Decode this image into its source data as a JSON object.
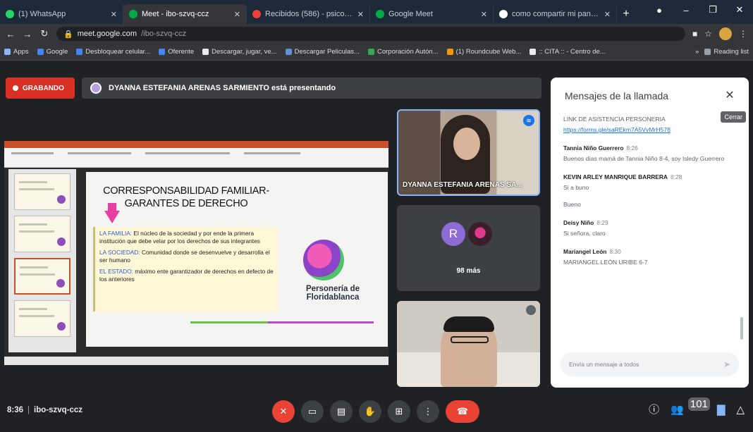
{
  "browser": {
    "tabs": [
      {
        "title": "(1) WhatsApp",
        "color": "#25d366",
        "active": false
      },
      {
        "title": "Meet - ibo-szvq-ccz",
        "color": "#00ac47",
        "active": true
      },
      {
        "title": "Recibidos (586) - psicogame",
        "color": "#ea4335",
        "active": false
      },
      {
        "title": "Google Meet",
        "color": "#00ac47",
        "active": false
      },
      {
        "title": "como compartir mi pantalla",
        "color": "#ffffff",
        "active": false
      }
    ],
    "url_host": "meet.google.com",
    "url_path": "/ibo-szvq-ccz",
    "bookmarks": [
      {
        "label": "Apps",
        "color": "#8ab4f8"
      },
      {
        "label": "Google",
        "color": "#4285f4"
      },
      {
        "label": "Desbloquear celular...",
        "color": "#4285f4"
      },
      {
        "label": "Oferente",
        "color": "#4285f4"
      },
      {
        "label": "Descargar, jugar, ve...",
        "color": "#e8eaed"
      },
      {
        "label": "Descargar Peliculas...",
        "color": "#5f8fd6"
      },
      {
        "label": "Corporación Autón...",
        "color": "#34a853"
      },
      {
        "label": "(1) Roundcube Web...",
        "color": "#f29900"
      },
      {
        "label": ":: CITA :: - Centro de...",
        "color": "#e8eaed"
      }
    ],
    "reading_list": "Reading list"
  },
  "meet": {
    "recording_label": "GRABANDO",
    "presenting_text": "DYANNA ESTEFANIA ARENAS SARMIENTO está presentando",
    "slide": {
      "title": "CORRESPONSABILIDAD FAMILIAR-\nGARANTES DE DERECHO",
      "items": [
        {
          "key": "LA FAMILIA:",
          "text": " El núcleo de la sociedad y por ende la primera institución que debe velar por los derechos de sus integrantes"
        },
        {
          "key": "LA SOCIEDAD:",
          "text": " Comunidad donde se desenvuelve y desarrolla el ser humano"
        },
        {
          "key": "EL ESTADO:",
          "text": " máximo ente garantizador de derechos en defecto de los anteriores"
        }
      ],
      "brand": "Personería de\nFloridablanca"
    },
    "participants": {
      "presenter_name": "DYANNA ESTEFANIA ARENAS SA...",
      "avatar_letter": "R",
      "more_label": "98 más"
    },
    "chat": {
      "title": "Mensajes de la llamada",
      "close_tooltip": "Cerrar",
      "messages": [
        {
          "author": "",
          "time": "",
          "body": "LINK DE ASISTENCIA PERSONERIA",
          "link": "https://forms.gle/saREkm7A5VvMrH578"
        },
        {
          "author": "Tannia Niño Guerrero",
          "time": "8:26",
          "body": "Buenos días mamá de Tannia Niño 8-4, soy Isledy Guerrero",
          "link": ""
        },
        {
          "author": "KEVIN ARLEY MANRIQUE BARRERA",
          "time": "8:28",
          "body": "Si a buno\n\nBueno",
          "link": ""
        },
        {
          "author": "Deisy Niño",
          "time": "8:29",
          "body": "Si señora, claro",
          "link": ""
        },
        {
          "author": "Mariangel León",
          "time": "8:30",
          "body": "MARIANGEL LEÓN URIBE 6-7",
          "link": ""
        }
      ],
      "input_placeholder": "Envía un mensaje a todos"
    },
    "bottom": {
      "time": "8:36",
      "meeting_code": "ibo-szvq-ccz",
      "participants_count": "101"
    }
  }
}
